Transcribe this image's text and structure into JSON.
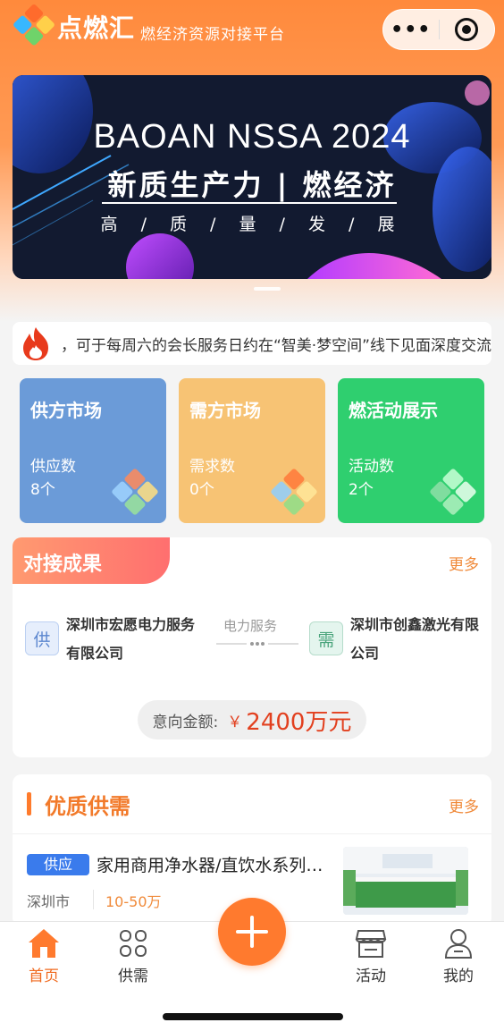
{
  "header": {
    "brand": "点燃汇",
    "slogan": "燃经济资源对接平台",
    "menu_label": "•••"
  },
  "banner": {
    "title": "BAOAN NSSA 2024",
    "subtitle": "新质生产力 | 燃经济",
    "tagline": "高 / 质 / 量 / 发 / 展"
  },
  "notice": {
    "text": "，可于每周六的会长服务日约在“智美·梦空间”线下见面深度交流"
  },
  "markets": [
    {
      "title": "供方市场",
      "label": "供应数",
      "value": "8个",
      "color": "#6b9bd8"
    },
    {
      "title": "需方市场",
      "label": "需求数",
      "value": "0个",
      "color": "#f7c374"
    },
    {
      "title": "燃活动展示",
      "label": "活动数",
      "value": "2个",
      "color": "#2fcf6f"
    }
  ],
  "results": {
    "title": "对接成果",
    "more": "更多",
    "supplier_tag": "供",
    "supplier_name_1": "深圳市宏愿电力服务",
    "supplier_name_2": "有限公司",
    "service": "电力服务",
    "demander_tag": "需",
    "demander_name_1": "深圳市创鑫激光有限",
    "demander_name_2": "公司",
    "amount_label": "意向金额:",
    "amount_currency": "￥",
    "amount_value": "2400万元"
  },
  "supply_demand": {
    "title": "优质供需",
    "more": "更多",
    "item": {
      "badge": "供应",
      "title": "家用商用净水器/直饮水系列…",
      "city": "深圳市",
      "price": "10-50万"
    }
  },
  "tabbar": [
    {
      "label": "首页",
      "active": true
    },
    {
      "label": "供需",
      "active": false
    },
    {
      "label": "活动",
      "active": false
    },
    {
      "label": "我的",
      "active": false
    }
  ],
  "colors": {
    "accent": "#ff7a2e",
    "active_tab": "#f06a1f",
    "price": "#e2401f"
  }
}
